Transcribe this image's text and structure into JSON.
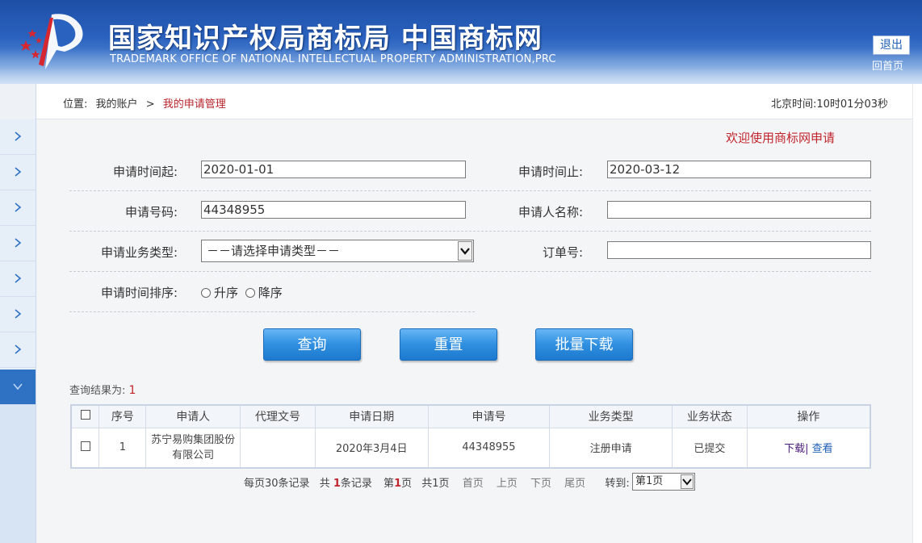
{
  "header": {
    "title_cn": "国家知识产权局商标局 中国商标网",
    "title_en": "TRADEMARK OFFICE OF NATIONAL INTELLECTUAL PROPERTY ADMINISTRATION,PRC",
    "logout": "退出",
    "home": "回首页"
  },
  "breadcrumb": {
    "prefix": "位置:",
    "account": "我的账户",
    "sep": ">",
    "current": "我的申请管理"
  },
  "clock": "北京时间:10时01分03秒",
  "welcome": "欢迎使用商标网申请系统",
  "form": {
    "start_label": "申请时间起:",
    "start_value": "2020-01-01",
    "end_label": "申请时间止:",
    "end_value": "2020-03-12",
    "appno_label": "申请号码:",
    "appno_value": "44348955",
    "applicant_label": "申请人名称:",
    "applicant_value": "",
    "biztype_label": "申请业务类型:",
    "biztype_selected": "－－请选择申请类型－－",
    "order_label": "订单号:",
    "order_value": "",
    "sort_label": "申请时间排序:",
    "sort_asc": "升序",
    "sort_desc": "降序"
  },
  "buttons": {
    "query": "查询",
    "reset": "重置",
    "batch": "批量下载"
  },
  "results": {
    "label": "查询结果为:",
    "count": "1"
  },
  "table": {
    "headers": [
      "序号",
      "申请人",
      "代理文号",
      "申请日期",
      "申请号",
      "业务类型",
      "业务状态",
      "操作"
    ],
    "rows": [
      {
        "index": "1",
        "applicant": "苏宁易购集团股份有限公司",
        "agent_no": "",
        "date": "2020年3月4日",
        "app_no": "44348955",
        "type": "注册申请",
        "status": "已提交",
        "download": "下载",
        "sep": "|",
        "view": "查看"
      }
    ]
  },
  "pager": {
    "per_page": "每页30条记录",
    "total_prefix": "共",
    "total_num": "1",
    "total_suffix": "条记录",
    "page_prefix": "第",
    "page_num": "1",
    "page_suffix": "页",
    "pages": "共1页",
    "first": "首页",
    "prev": "上页",
    "next": "下页",
    "last": "尾页",
    "goto": "转到:",
    "goto_value": "第1页"
  },
  "colors": {
    "accent": "#2f8fe0",
    "highlight_red": "#c0252c",
    "banner": "#2a62bf"
  }
}
